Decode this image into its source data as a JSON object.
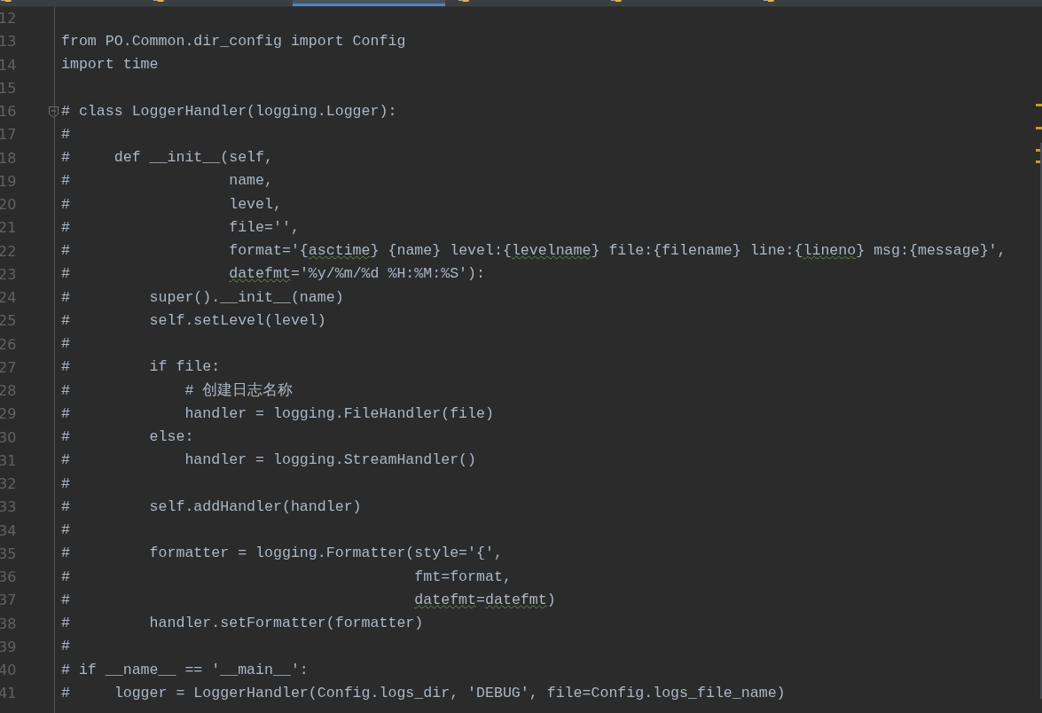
{
  "tabs": [
    {
      "selected": false
    },
    {
      "selected": false
    },
    {
      "selected": true
    },
    {
      "selected": false
    },
    {
      "selected": false
    },
    {
      "selected": false
    }
  ],
  "editor": {
    "lines": [
      {
        "number": "12",
        "fold": false
      },
      {
        "number": "13",
        "fold": false,
        "segments": [
          {
            "text": "from PO.Common.dir_config import Config",
            "typo": false
          }
        ]
      },
      {
        "number": "14",
        "fold": false,
        "segments": [
          {
            "text": "import time",
            "typo": false
          }
        ]
      },
      {
        "number": "15",
        "fold": false
      },
      {
        "number": "16",
        "fold": true,
        "segments": [
          {
            "text": "# class LoggerHandler(logging.Logger):",
            "typo": false
          }
        ]
      },
      {
        "number": "17",
        "fold": false,
        "segments": [
          {
            "text": "#",
            "typo": false
          }
        ]
      },
      {
        "number": "18",
        "fold": false,
        "segments": [
          {
            "text": "#     def __init__(self,",
            "typo": false
          }
        ]
      },
      {
        "number": "19",
        "fold": false,
        "segments": [
          {
            "text": "#                  name,",
            "typo": false
          }
        ]
      },
      {
        "number": "20",
        "fold": false,
        "segments": [
          {
            "text": "#                  level,",
            "typo": false
          }
        ]
      },
      {
        "number": "21",
        "fold": false,
        "segments": [
          {
            "text": "#                  file='',",
            "typo": false
          }
        ]
      },
      {
        "number": "22",
        "fold": false,
        "segments": [
          {
            "text": "#                  format='{",
            "typo": false
          },
          {
            "text": "asctime",
            "typo": true
          },
          {
            "text": "} {name} level:{",
            "typo": false
          },
          {
            "text": "levelname",
            "typo": true
          },
          {
            "text": "} file:{filename} line:{",
            "typo": false
          },
          {
            "text": "lineno",
            "typo": true
          },
          {
            "text": "} msg:{message}',",
            "typo": false
          }
        ]
      },
      {
        "number": "23",
        "fold": false,
        "segments": [
          {
            "text": "#                  ",
            "typo": false
          },
          {
            "text": "datefmt",
            "typo": true
          },
          {
            "text": "='%y/%m/%d %H:%M:%S'):",
            "typo": false
          }
        ]
      },
      {
        "number": "24",
        "fold": false,
        "segments": [
          {
            "text": "#         super().__init__(name)",
            "typo": false
          }
        ]
      },
      {
        "number": "25",
        "fold": false,
        "segments": [
          {
            "text": "#         self.setLevel(level)",
            "typo": false
          }
        ]
      },
      {
        "number": "26",
        "fold": false,
        "segments": [
          {
            "text": "#",
            "typo": false
          }
        ]
      },
      {
        "number": "27",
        "fold": false,
        "segments": [
          {
            "text": "#         if file:",
            "typo": false
          }
        ]
      },
      {
        "number": "28",
        "fold": false,
        "segments": [
          {
            "text": "#             # 创建日志名称",
            "typo": false
          }
        ]
      },
      {
        "number": "29",
        "fold": false,
        "segments": [
          {
            "text": "#             handler = logging.FileHandler(file)",
            "typo": false
          }
        ]
      },
      {
        "number": "30",
        "fold": false,
        "segments": [
          {
            "text": "#         else:",
            "typo": false
          }
        ]
      },
      {
        "number": "31",
        "fold": false,
        "segments": [
          {
            "text": "#             handler = logging.StreamHandler()",
            "typo": false
          }
        ]
      },
      {
        "number": "32",
        "fold": false,
        "segments": [
          {
            "text": "#",
            "typo": false
          }
        ]
      },
      {
        "number": "33",
        "fold": false,
        "segments": [
          {
            "text": "#         self.addHandler(handler)",
            "typo": false
          }
        ]
      },
      {
        "number": "34",
        "fold": false,
        "segments": [
          {
            "text": "#",
            "typo": false
          }
        ]
      },
      {
        "number": "35",
        "fold": false,
        "segments": [
          {
            "text": "#         formatter = logging.Formatter(style='{',",
            "typo": false
          }
        ]
      },
      {
        "number": "36",
        "fold": false,
        "segments": [
          {
            "text": "#                                       fmt=format,",
            "typo": false
          }
        ]
      },
      {
        "number": "37",
        "fold": false,
        "segments": [
          {
            "text": "#                                       ",
            "typo": false
          },
          {
            "text": "datefmt",
            "typo": true
          },
          {
            "text": "=",
            "typo": false
          },
          {
            "text": "datefmt",
            "typo": true
          },
          {
            "text": ")",
            "typo": false
          }
        ]
      },
      {
        "number": "38",
        "fold": false,
        "segments": [
          {
            "text": "#         handler.setFormatter(formatter)",
            "typo": false
          }
        ]
      },
      {
        "number": "39",
        "fold": false,
        "segments": [
          {
            "text": "#",
            "typo": false
          }
        ]
      },
      {
        "number": "40",
        "fold": false,
        "segments": [
          {
            "text": "# if __name__ == '__main__':",
            "typo": false
          }
        ]
      },
      {
        "number": "41",
        "fold": false,
        "segments": [
          {
            "text": "#     logger = LoggerHandler(Config.logs_dir, 'DEBUG', file=Config.logs_file_name)",
            "typo": false
          }
        ]
      }
    ]
  }
}
